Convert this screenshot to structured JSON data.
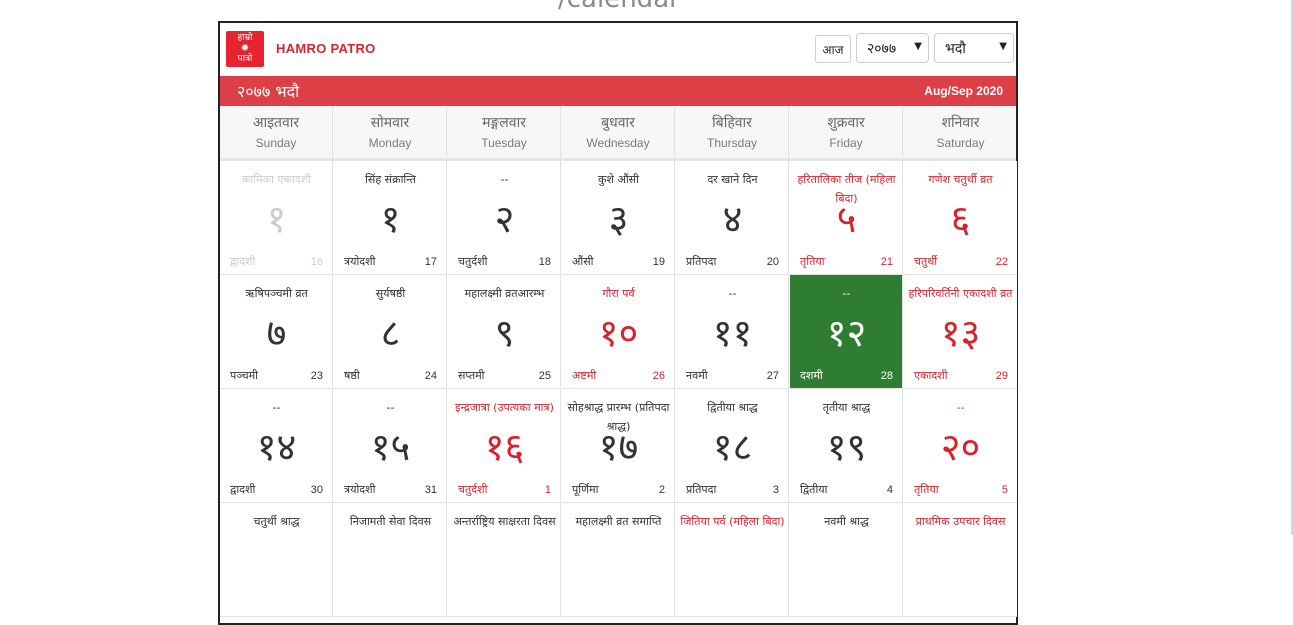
{
  "page_heading": "/calendar",
  "brand": {
    "logo_text_line1": "हाम्रो",
    "logo_text_line2": "पात्रो",
    "name": "HAMRO PATRO"
  },
  "controls": {
    "today_label": "आज",
    "year_value": "२०७७",
    "month_value": "भदौ"
  },
  "month_bar": {
    "nepali_month": "२०७७ भदौ",
    "english_months": "Aug/Sep 2020",
    "color": "#dc3f45"
  },
  "weekdays": [
    {
      "np": "आइतवार",
      "en": "Sunday"
    },
    {
      "np": "सोमवार",
      "en": "Monday"
    },
    {
      "np": "मङ्गलवार",
      "en": "Tuesday"
    },
    {
      "np": "बुधवार",
      "en": "Wednesday"
    },
    {
      "np": "बिहिवार",
      "en": "Thursday"
    },
    {
      "np": "शुक्रवार",
      "en": "Friday"
    },
    {
      "np": "शनिवार",
      "en": "Saturday"
    }
  ],
  "weeks": [
    [
      {
        "event": "कामिका एकादशी",
        "day": "१",
        "tithi": "द्वादशी",
        "ad": "16",
        "state": "faded"
      },
      {
        "event": "सिंह संक्रान्ति",
        "day": "१",
        "tithi": "त्रयोदशी",
        "ad": "17",
        "state": "normal"
      },
      {
        "event": "--",
        "day": "२",
        "tithi": "चतुर्दशी",
        "ad": "18",
        "state": "normal"
      },
      {
        "event": "कुशे औंसी",
        "day": "३",
        "tithi": "औंसी",
        "ad": "19",
        "state": "normal"
      },
      {
        "event": "दर खाने दिन",
        "day": "४",
        "tithi": "प्रतिपदा",
        "ad": "20",
        "state": "normal"
      },
      {
        "event": "हरितालिका तीज (महिला बिदा)",
        "day": "५",
        "tithi": "तृतिया",
        "ad": "21",
        "state": "holiday"
      },
      {
        "event": "गणेश चतुर्थी व्रत",
        "day": "६",
        "tithi": "चतुर्थी",
        "ad": "22",
        "state": "holiday"
      }
    ],
    [
      {
        "event": "ऋषिपञ्चमी व्रत",
        "day": "७",
        "tithi": "पञ्चमी",
        "ad": "23",
        "state": "normal"
      },
      {
        "event": "सुर्यषष्ठी",
        "day": "८",
        "tithi": "षष्ठी",
        "ad": "24",
        "state": "normal"
      },
      {
        "event": "महालक्ष्मी व्रतआरम्भ",
        "day": "९",
        "tithi": "सप्तमी",
        "ad": "25",
        "state": "normal"
      },
      {
        "event": "गौरा पर्व",
        "day": "१०",
        "tithi": "अष्टमी",
        "ad": "26",
        "state": "holiday"
      },
      {
        "event": "--",
        "day": "११",
        "tithi": "नवमी",
        "ad": "27",
        "state": "normal"
      },
      {
        "event": "--",
        "day": "१२",
        "tithi": "दशमी",
        "ad": "28",
        "state": "today"
      },
      {
        "event": "हरिपरिवर्तिनी एकादशी व्रत",
        "day": "१३",
        "tithi": "एकादशी",
        "ad": "29",
        "state": "holiday"
      }
    ],
    [
      {
        "event": "--",
        "day": "१४",
        "tithi": "द्वादशी",
        "ad": "30",
        "state": "normal"
      },
      {
        "event": "--",
        "day": "१५",
        "tithi": "त्रयोदशी",
        "ad": "31",
        "state": "normal"
      },
      {
        "event": "इन्द्रजात्रा (उपत्यका मात्र)",
        "day": "१६",
        "tithi": "चतुर्दशी",
        "ad": "1",
        "state": "holiday"
      },
      {
        "event": "सोहश्राद्ध प्रारम्भ (प्रतिपदा श्राद्ध)",
        "day": "१७",
        "tithi": "पूर्णिमा",
        "ad": "2",
        "state": "normal"
      },
      {
        "event": "द्वितीया श्राद्ध",
        "day": "१८",
        "tithi": "प्रतिपदा",
        "ad": "3",
        "state": "normal"
      },
      {
        "event": "तृतीया श्राद्ध",
        "day": "१९",
        "tithi": "द्वितीया",
        "ad": "4",
        "state": "normal"
      },
      {
        "event": "--",
        "day": "२०",
        "tithi": "तृतिया",
        "ad": "5",
        "state": "holiday"
      }
    ],
    [
      {
        "event": "चतुर्थी श्राद्ध",
        "day": "",
        "tithi": "",
        "ad": "",
        "state": "normal"
      },
      {
        "event": "निजामती सेवा दिवस",
        "day": "",
        "tithi": "",
        "ad": "",
        "state": "normal"
      },
      {
        "event": "अन्तर्राष्ट्रिय साक्षरता दिवस",
        "day": "",
        "tithi": "",
        "ad": "",
        "state": "normal"
      },
      {
        "event": "महालक्ष्मी व्रत समाप्ति",
        "day": "",
        "tithi": "",
        "ad": "",
        "state": "normal"
      },
      {
        "event": "जितिया पर्व (महिला बिदा)",
        "day": "",
        "tithi": "",
        "ad": "",
        "state": "holiday"
      },
      {
        "event": "नवमी श्राद्ध",
        "day": "",
        "tithi": "",
        "ad": "",
        "state": "normal"
      },
      {
        "event": "प्राथमिक उपचार दिवस",
        "day": "",
        "tithi": "",
        "ad": "",
        "state": "holiday"
      }
    ]
  ],
  "colors": {
    "holiday": "#d8232f",
    "today_bg": "#2f7d32",
    "faded": "#cdcdcd"
  }
}
